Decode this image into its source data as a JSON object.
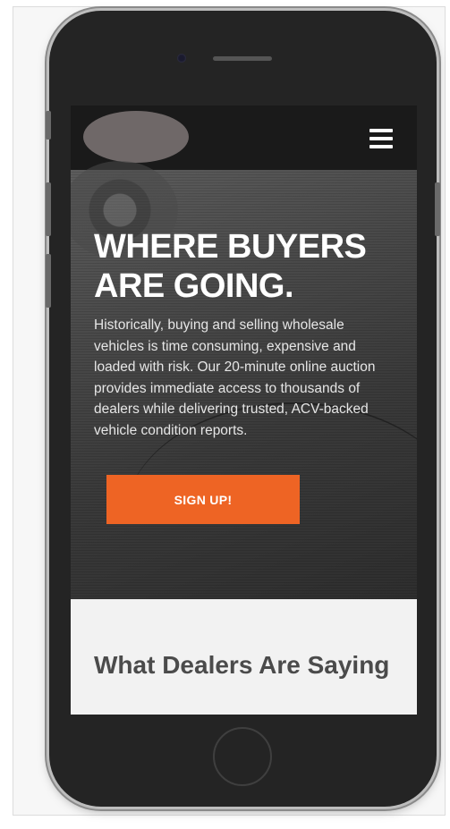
{
  "header": {
    "logo_icon": "logo-placeholder",
    "menu_icon": "hamburger-menu-icon"
  },
  "hero": {
    "title": "WHERE BUYERS ARE GOING.",
    "description": "Historically, buying and selling wholesale vehicles is time consuming, expensive and loaded with risk. Our 20-minute online auction provides immediate access to thousands of dealers while delivering trusted, ACV-backed vehicle condition reports.",
    "cta_label": "SIGN UP!",
    "accent_color": "#ee6424"
  },
  "testimonials": {
    "heading": "What Dealers Are Saying"
  }
}
